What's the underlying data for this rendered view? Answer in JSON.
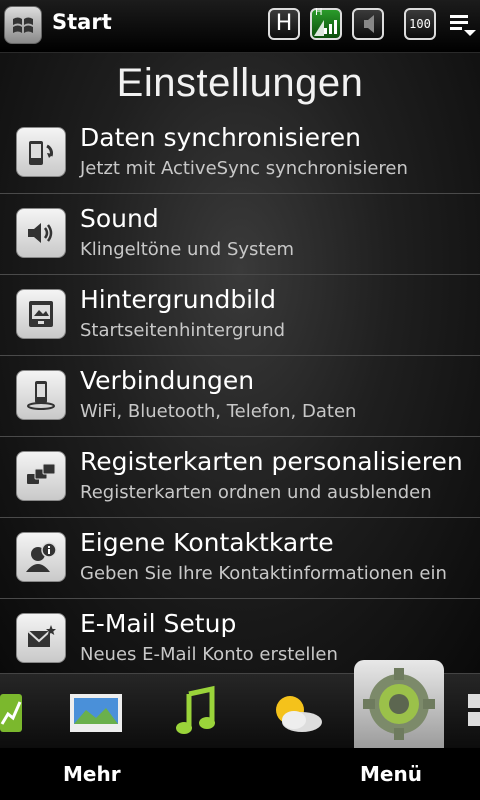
{
  "status_bar": {
    "start_label": "Start",
    "network_type": "H",
    "signal_tag": "H",
    "battery": "100",
    "icons": [
      "windows-start-icon",
      "network-h-icon",
      "signal-icon",
      "volume-icon",
      "battery-icon",
      "menu-icon"
    ]
  },
  "page": {
    "title": "Einstellungen"
  },
  "settings": [
    {
      "title": "Daten synchronisieren",
      "subtitle": "Jetzt mit ActiveSync synchronisieren",
      "icon": "sync-icon"
    },
    {
      "title": "Sound",
      "subtitle": "Klingeltöne und System",
      "icon": "speaker-icon"
    },
    {
      "title": "Hintergrundbild",
      "subtitle": "Startseitenhintergrund",
      "icon": "wallpaper-icon"
    },
    {
      "title": "Verbindungen",
      "subtitle": "WiFi, Bluetooth, Telefon, Daten",
      "icon": "phone-connection-icon"
    },
    {
      "title": "Registerkarten personalisieren",
      "subtitle": "Registerkarten ordnen und ausblenden",
      "icon": "tabs-icon"
    },
    {
      "title": "Eigene Kontaktkarte",
      "subtitle": "Geben Sie Ihre Kontaktinformationen ein",
      "icon": "contact-card-icon"
    },
    {
      "title": "E-Mail Setup",
      "subtitle": "Neues E-Mail Konto erstellen",
      "icon": "email-setup-icon"
    }
  ],
  "dock": {
    "tabs": [
      "stocks-icon",
      "photos-icon",
      "music-icon",
      "weather-icon",
      "settings-gear-icon",
      "more-tabs-icon"
    ],
    "selected": "settings-gear-icon"
  },
  "softkeys": {
    "left": "Mehr",
    "right": "Menü"
  }
}
